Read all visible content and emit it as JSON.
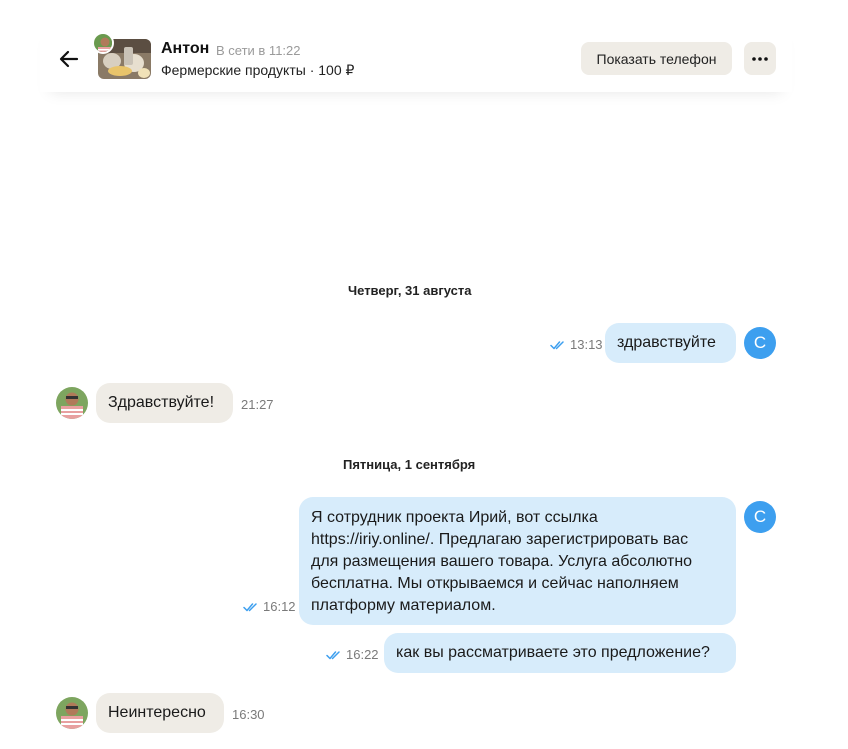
{
  "header": {
    "seller_name": "Антон",
    "seller_status": "В сети в 11:22",
    "ad_title": "Фермерские продукты · 100 ₽",
    "show_phone_label": "Показать телефон",
    "more_icon": "ellipsis-icon",
    "back_icon": "arrow-left-icon"
  },
  "colors": {
    "incoming_bubble": "#efece6",
    "outgoing_bubble": "#d7ecfb",
    "user_avatar": "#3d9fef",
    "read_ticks": "#3d9fef"
  },
  "dates": {
    "first": "Четверг, 31 августа",
    "second": "Пятница, 1 сентября"
  },
  "messages": [
    {
      "direction": "out",
      "text": "здравствуйте",
      "time": "13:13",
      "read": true,
      "avatar_letter": "С"
    },
    {
      "direction": "in",
      "text": "Здравствуйте!",
      "time": "21:27"
    },
    {
      "direction": "out",
      "lines": [
        "Я сотрудник проекта Ирий, вот ссылка",
        "https://iriy.online/. Предлагаю зарегистрировать вас",
        "для размещения вашего товара. Услуга абсолютно",
        "бесплатна. Мы открываемся и сейчас наполняем",
        "платформу материалом."
      ],
      "time": "16:12",
      "read": true,
      "avatar_letter": "С"
    },
    {
      "direction": "out",
      "text": "как вы рассматриваете это предложение?",
      "time": "16:22",
      "read": true
    },
    {
      "direction": "in",
      "text": "Неинтересно",
      "time": "16:30"
    }
  ]
}
